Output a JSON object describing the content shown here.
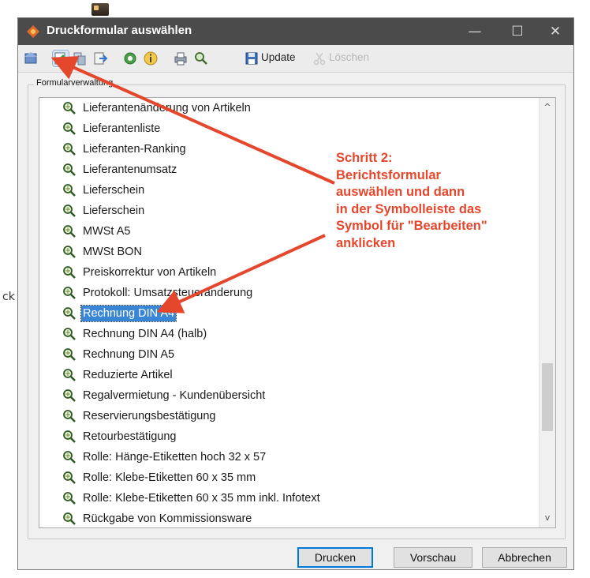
{
  "window": {
    "title": "Druckformular auswählen",
    "minimize_glyph": "—",
    "maximize_glyph": "☐",
    "close_glyph": "✕"
  },
  "background": {
    "side_letter": "ck"
  },
  "toolbar": {
    "update_label": "Update",
    "delete_label": "Löschen",
    "icons": [
      "home-icon",
      "edit-form-icon",
      "copy-icon",
      "export-icon",
      "settings-icon",
      "info-icon",
      "print-icon",
      "search-icon"
    ]
  },
  "group": {
    "label": "Formularverwaltung"
  },
  "list": {
    "items": [
      "Lieferantenänderung von Artikeln",
      "Lieferantenliste",
      "Lieferanten-Ranking",
      "Lieferantenumsatz",
      "Lieferschein",
      "Lieferschein",
      "MWSt A5",
      "MWSt BON",
      "Preiskorrektur von Artikeln",
      "Protokoll: Umsatzsteueränderung",
      "Rechnung DIN A4",
      "Rechnung DIN A4 (halb)",
      "Rechnung DIN A5",
      "Reduzierte Artikel",
      "Regalvermietung - Kundenübersicht",
      "Reservierungsbestätigung",
      "Retourbestätigung",
      "Rolle: Hänge-Etiketten hoch 32 x 57",
      "Rolle: Klebe-Etiketten 60 x 35 mm",
      "Rolle: Klebe-Etiketten 60 x 35 mm inkl. Infotext",
      "Rückgabe von Kommissionsware"
    ],
    "selected_index": 10,
    "scroll_up": "^",
    "scroll_down": "v"
  },
  "buttons": {
    "print": "Drucken",
    "preview": "Vorschau",
    "cancel": "Abbrechen"
  },
  "annotation": {
    "lines": [
      "Schritt 2:",
      "Berichtsformular",
      "auswählen und dann",
      "in der Symbolleiste das",
      "Symbol für \"Bearbeiten\"",
      "anklicken"
    ],
    "color": "#e5472d"
  },
  "colors": {
    "titlebar": "#4b4b4b",
    "selection": "#3a86d6",
    "default_button_border": "#0078d7"
  }
}
